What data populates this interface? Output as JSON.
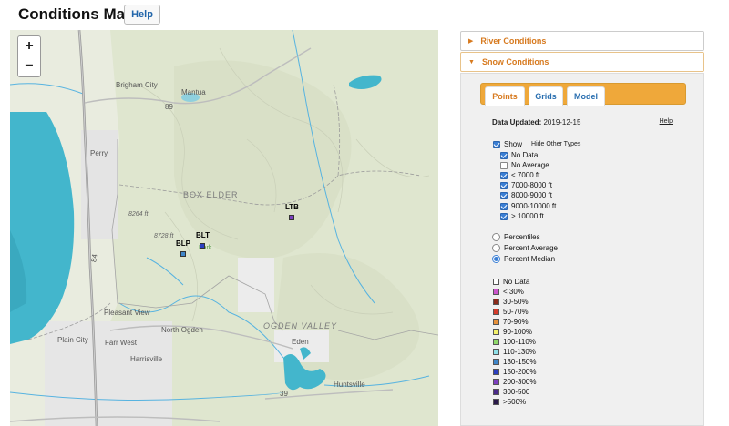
{
  "header": {
    "title": "Conditions Map",
    "help_label": "Help"
  },
  "map": {
    "zoom_in": "+",
    "zoom_out": "−",
    "labels": {
      "brigham_city": "Brigham City",
      "mantua": "Mantua",
      "perry": "Perry",
      "box_elder": "BOX ELDER",
      "elev_8264": "8264 ft",
      "elev_8728": "8728 ft",
      "park": "Park",
      "pleasant_view": "Pleasant View",
      "north_ogden": "North Ogden",
      "plain_city": "Plain City",
      "farr_west": "Farr West",
      "harrisville": "Harrisville",
      "ogden_valley": "OGDEN VALLEY",
      "eden": "Eden",
      "huntsville": "Huntsville",
      "hwy_84": "84",
      "hwy_89": "89",
      "hwy_39": "39"
    },
    "stations": [
      {
        "code": "LTB",
        "color": "#7b3fbf"
      },
      {
        "code": "BLT",
        "color": "#2b3fbf"
      },
      {
        "code": "BLP",
        "color": "#3f86c9"
      }
    ]
  },
  "panel": {
    "river_label": "River Conditions",
    "snow_label": "Snow Conditions",
    "tabs": [
      "Points",
      "Grids",
      "Model"
    ],
    "updated_label": "Data Updated:",
    "updated_value": "2019-12-15",
    "help_label": "Help",
    "show_label": "Show",
    "hide_other_label": "Hide Other Types",
    "types": [
      {
        "label": "No Data",
        "checked": true
      },
      {
        "label": "No Average",
        "checked": false
      },
      {
        "label": "< 7000 ft",
        "checked": true
      },
      {
        "label": "7000-8000 ft",
        "checked": true
      },
      {
        "label": "8000-9000 ft",
        "checked": true
      },
      {
        "label": "9000-10000 ft",
        "checked": true
      },
      {
        "label": "> 10000 ft",
        "checked": true
      }
    ],
    "modes": [
      {
        "label": "Percentiles",
        "selected": false
      },
      {
        "label": "Percent Average",
        "selected": false
      },
      {
        "label": "Percent Median",
        "selected": true
      }
    ],
    "legend": [
      {
        "label": "No Data",
        "color": "#ffffff"
      },
      {
        "label": "< 30%",
        "color": "#cc55cc"
      },
      {
        "label": "30-50%",
        "color": "#8b2a1a"
      },
      {
        "label": "50-70%",
        "color": "#d43a2a"
      },
      {
        "label": "70-90%",
        "color": "#e7913a"
      },
      {
        "label": "90-100%",
        "color": "#f3f06a"
      },
      {
        "label": "100-110%",
        "color": "#8fd86a"
      },
      {
        "label": "110-130%",
        "color": "#8fe0e8"
      },
      {
        "label": "130-150%",
        "color": "#3f86c9"
      },
      {
        "label": "150-200%",
        "color": "#2b3fbf"
      },
      {
        "label": "200-300%",
        "color": "#7b3fbf"
      },
      {
        "label": "300-500",
        "color": "#4a2a8a"
      },
      {
        "label": ">500%",
        "color": "#2a1a4a"
      }
    ]
  }
}
